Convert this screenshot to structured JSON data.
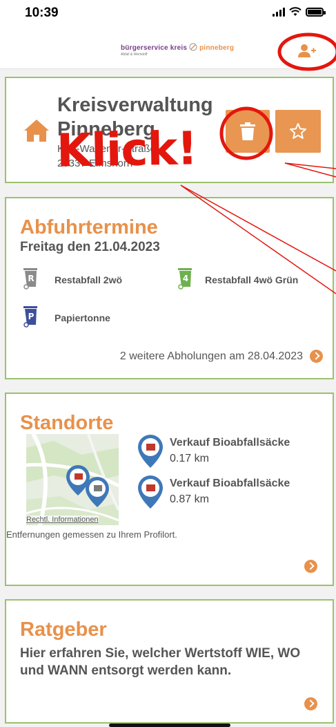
{
  "status_bar": {
    "time": "10:39",
    "battery_level": 1.0
  },
  "header": {
    "logo_text_prefix": "bürgerservice kreis",
    "logo_text_suffix": "pinneberg",
    "logo_subtext": "Abfall & Wertstoff",
    "profile_icon": "add-user-icon"
  },
  "location": {
    "name_line1": "Kreisverwaltung",
    "name_line2": "Pinneberg",
    "address_line1": "Kurt-Wagener-Straße",
    "address_line2": "25337 Elmshorn",
    "icons": {
      "home": "home-icon",
      "trash": "trash-icon",
      "favorite": "star-icon"
    }
  },
  "termine": {
    "title": "Abfuhrtermine",
    "date": "Freitag den 21.04.2023",
    "bins": [
      {
        "letter": "R",
        "label": "Restabfall 2wö",
        "color": "#8a8a8a"
      },
      {
        "letter": "4",
        "label": "Restabfall 4wö Grün",
        "color": "#6db04e"
      },
      {
        "letter": "P",
        "label": "Papiertonne",
        "color": "#3d4f9a"
      }
    ],
    "more_text": "2 weitere Abholungen am 28.04.2023"
  },
  "standorte": {
    "title": "Standorte",
    "map_credit": "Rechtl. Informationen",
    "items": [
      {
        "title": "Verkauf Bioabfallsäcke",
        "distance": "0.17 km"
      },
      {
        "title": "Verkauf Bioabfallsäcke",
        "distance": "0.87 km"
      }
    ],
    "note": "Entfernungen gemessen zu Ihrem Profilort."
  },
  "ratgeber": {
    "title": "Ratgeber",
    "text": "Hier erfahren Sie, welcher Wertstoff WIE, WO und WANN entsorgt werden kann."
  },
  "annotation": {
    "text": "Klick!"
  },
  "colors": {
    "accent": "#e8914b",
    "card_border": "#9cc06d",
    "annotation_red": "#e3170e"
  }
}
